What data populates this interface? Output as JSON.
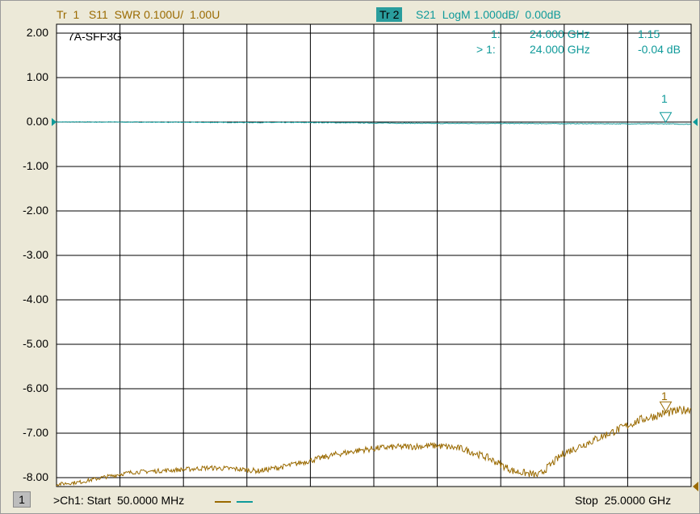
{
  "header": {
    "trace1": "Tr  1   S11  SWR 0.100U/  1.00U",
    "trace2_id": "Tr  2",
    "trace2": "S21  LogM 1.000dB/  0.00dB"
  },
  "markers": {
    "row1_label": "1:",
    "row1_freq": "24.000 GHz",
    "row1_val": "1.15",
    "row2_label": "> 1:",
    "row2_freq": "24.000 GHz",
    "row2_val": "-0.04 dB",
    "marker_id": "1"
  },
  "status": {
    "channel_badge": "1",
    "start": ">Ch1: Start  50.0000 MHz",
    "stop": "Stop  25.0000 GHz"
  },
  "colors": {
    "trace1": "#9a6a00",
    "trace2": "#0f9a9a",
    "grid": "#000000",
    "background": "#ffffff"
  },
  "chart_data": {
    "type": "line",
    "title": "7A-SFF3G",
    "x_unit": "GHz",
    "xlim": [
      0.05,
      25.0
    ],
    "ylim": [
      -8.2,
      2.2
    ],
    "grid": true,
    "y_ticks": [
      "2.00",
      "1.00",
      "0.00",
      "-1.00",
      "-2.00",
      "-3.00",
      "-4.00",
      "-5.00",
      "-6.00",
      "-7.00",
      "-8.00"
    ],
    "series": [
      {
        "id": "S21",
        "x": [
          0.05,
          2.5,
          5,
          7.5,
          10,
          12.5,
          15,
          17.5,
          20,
          22.5,
          24,
          25
        ],
        "y": [
          0.0,
          0.0,
          -0.005,
          -0.01,
          -0.01,
          -0.02,
          -0.03,
          -0.03,
          -0.035,
          -0.04,
          -0.04,
          -0.05
        ]
      },
      {
        "id": "S11",
        "x": [
          0.05,
          1,
          2,
          3,
          4,
          5,
          6,
          7,
          8,
          9,
          10,
          11,
          12,
          13,
          14,
          15,
          16,
          17,
          18,
          19,
          19.5,
          20,
          21,
          22,
          23,
          24,
          25
        ],
        "y": [
          -8.15,
          -8.1,
          -7.98,
          -7.88,
          -7.85,
          -7.82,
          -7.78,
          -7.8,
          -7.85,
          -7.75,
          -7.62,
          -7.48,
          -7.38,
          -7.32,
          -7.3,
          -7.28,
          -7.35,
          -7.55,
          -7.85,
          -7.95,
          -7.7,
          -7.45,
          -7.2,
          -6.95,
          -6.7,
          -6.55,
          -6.45
        ]
      }
    ]
  }
}
